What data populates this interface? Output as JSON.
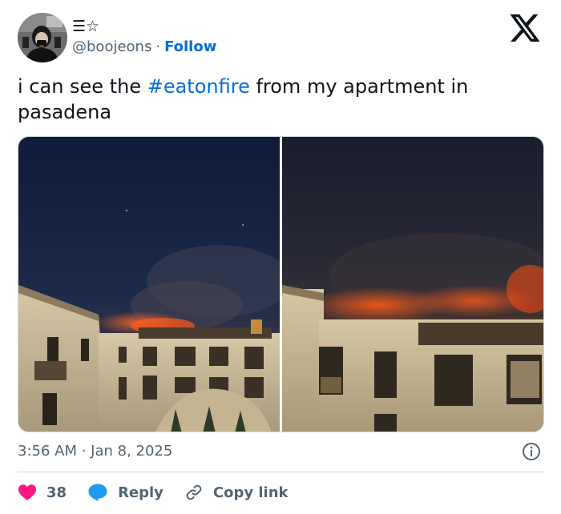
{
  "author": {
    "display_name": "☰☆",
    "handle": "@boojeons",
    "separator": "·",
    "follow_label": "Follow",
    "avatar_icon": "avatar-photo"
  },
  "tweet": {
    "text_before": "i can see the ",
    "hashtag": "#eatonfire",
    "text_after": " from my apartment in pasadena"
  },
  "media": {
    "photos": [
      "photo-fire-skyline-left",
      "photo-fire-skyline-right"
    ]
  },
  "meta": {
    "timestamp": "3:56 AM · Jan 8, 2025"
  },
  "actions": {
    "likes_count": "38",
    "reply_label": "Reply",
    "copy_link_label": "Copy link"
  },
  "colors": {
    "link": "#006fd6",
    "like": "#f91880",
    "reply_bubble": "#1d9bf0",
    "secondary_text": "#536471",
    "border": "#cfd9de"
  }
}
